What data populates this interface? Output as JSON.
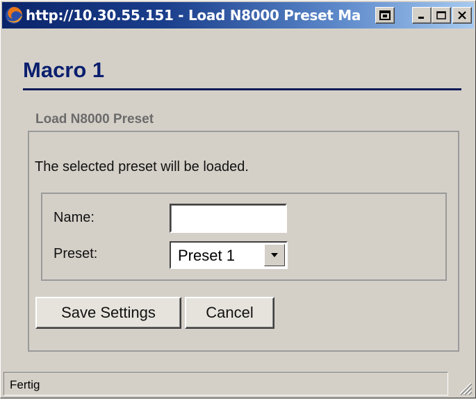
{
  "window": {
    "title": "http://10.30.55.151 - Load N8000 Preset Ma",
    "icon": "firefox-icon",
    "controls": [
      "popout-icon",
      "minimize-icon",
      "maximize-icon",
      "close-icon"
    ]
  },
  "page": {
    "heading": "Macro 1",
    "section_title": "Load N8000 Preset",
    "description": "The selected preset will be loaded."
  },
  "form": {
    "name_label": "Name:",
    "name_value": "",
    "preset_label": "Preset:",
    "preset_selected": "Preset 1"
  },
  "buttons": {
    "save": "Save Settings",
    "cancel": "Cancel"
  },
  "statusbar": {
    "text": "Fertig"
  },
  "colors": {
    "title_gradient_start": "#0a246a",
    "title_gradient_end": "#a6caf0",
    "heading": "#0a1f6e",
    "window_bg": "#d4d0c8"
  }
}
